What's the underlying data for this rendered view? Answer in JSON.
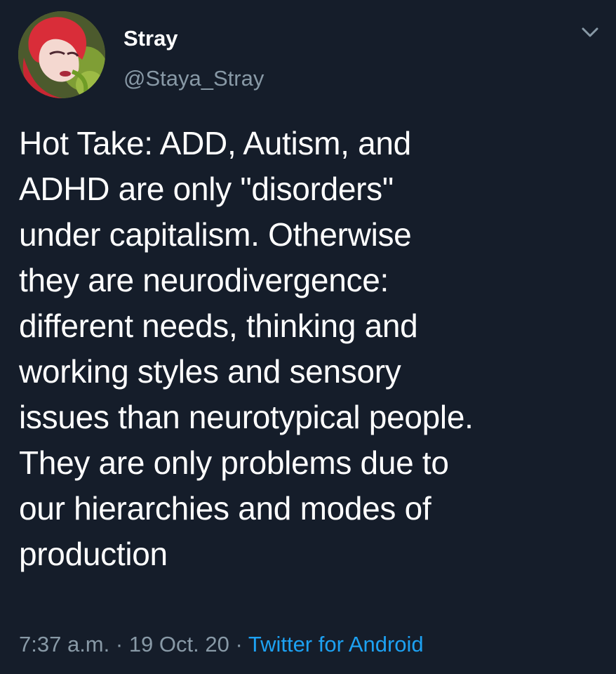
{
  "tweet": {
    "display_name": "Stray",
    "handle": "@Staya_Stray",
    "text": "Hot Take: ADD, Autism, and\nADHD are only \"disorders\"\nunder capitalism. Otherwise\nthey are neurodivergence:\ndifferent needs, thinking and\nworking styles and sensory\nissues than neurotypical people.\nThey are only problems due to\nour hierarchies and modes of\nproduction",
    "time": "7:37 a.m.",
    "date": "19 Oct. 20",
    "separator": " · ",
    "source": "Twitter for Android"
  },
  "icons": {
    "avatar": "profile-avatar",
    "menu": "chevron-down-icon"
  },
  "colors": {
    "background": "#151d2a",
    "text_primary": "#ffffff",
    "text_secondary": "#8899a6",
    "link": "#1da1f2"
  }
}
